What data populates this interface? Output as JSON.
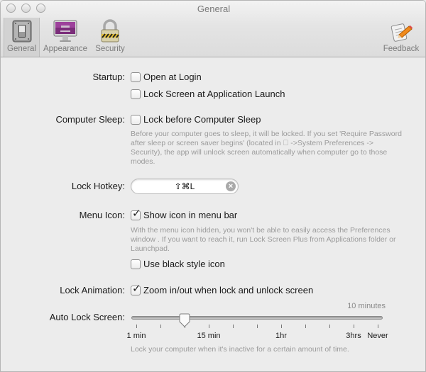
{
  "window": {
    "title": "General",
    "controls": [
      "close",
      "minimize",
      "zoom"
    ]
  },
  "toolbar": {
    "items": [
      {
        "label": "General",
        "icon": "switch-icon",
        "selected": true
      },
      {
        "label": "Appearance",
        "icon": "imac-display-icon",
        "selected": false
      },
      {
        "label": "Security",
        "icon": "padlock-icon",
        "selected": false
      },
      {
        "label": "Feedback",
        "icon": "note-pencil-icon",
        "selected": false
      }
    ]
  },
  "startup": {
    "label": "Startup:",
    "options": [
      {
        "label": "Open at Login",
        "checked": false
      },
      {
        "label": "Lock Screen at Application Launch",
        "checked": false
      }
    ]
  },
  "computer_sleep": {
    "label": "Computer Sleep:",
    "option": {
      "label": "Lock before Computer Sleep",
      "checked": false
    },
    "help_lines": [
      "Before your computer goes to sleep, it will be locked. If you set 'Require Password",
      "after sleep or screen saver begins' (located in  ->System Preferences ->",
      "Security), the app will unlock screen automatically when computer go to those",
      "modes."
    ]
  },
  "lock_hotkey": {
    "label": "Lock Hotkey:",
    "value": "⇧⌘L",
    "clear_icon": "clear-circle-icon"
  },
  "menu_icon": {
    "label": "Menu Icon:",
    "option": {
      "label": "Show icon in menu bar",
      "checked": true
    },
    "help_lines": [
      "With the menu icon hidden, you won't be able to easily access the Preferences",
      "window . If you want to reach it, run Lock Screen Plus from Applications folder or",
      "Launchpad."
    ],
    "option2": {
      "label": "Use black style icon",
      "checked": false
    }
  },
  "lock_animation": {
    "label": "Lock Animation:",
    "option": {
      "label": "Zoom in/out when lock and unlock screen",
      "checked": true
    }
  },
  "auto_lock": {
    "label": "Auto Lock Screen:",
    "value_text": "10 minutes",
    "tick_count": 11,
    "selected_tick_index": 2,
    "tick_labels": [
      {
        "tick": 0,
        "label": "1 min"
      },
      {
        "tick": 3,
        "label": "15 min"
      },
      {
        "tick": 6,
        "label": "1hr"
      },
      {
        "tick": 9,
        "label": "3hrs"
      },
      {
        "tick": 10,
        "label": "Never"
      }
    ],
    "help": "Lock your computer when it's inactive for a certain amount of time."
  }
}
